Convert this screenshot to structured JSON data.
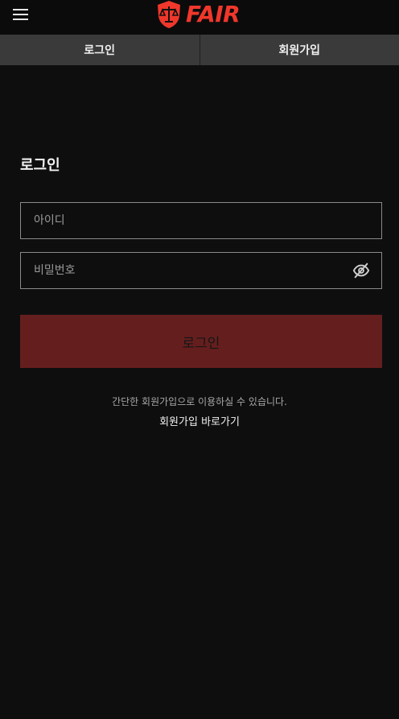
{
  "header": {
    "logo_text": "FAIR",
    "brand_color": "#f0372b",
    "menu_icon": "hamburger-menu-icon",
    "logo_icon": "scales-shield-icon"
  },
  "tabs": [
    {
      "label": "로그인"
    },
    {
      "label": "회원가입"
    }
  ],
  "login": {
    "title": "로그인",
    "id_placeholder": "아이디",
    "password_placeholder": "비밀번호",
    "password_toggle_icon": "eye-off-icon",
    "submit_label": "로그인",
    "submit_color": "#651e1e",
    "hint_text": "간단한 회원가입으로 이용하실 수 있습니다.",
    "signup_link": "회원가입 바로가기"
  }
}
